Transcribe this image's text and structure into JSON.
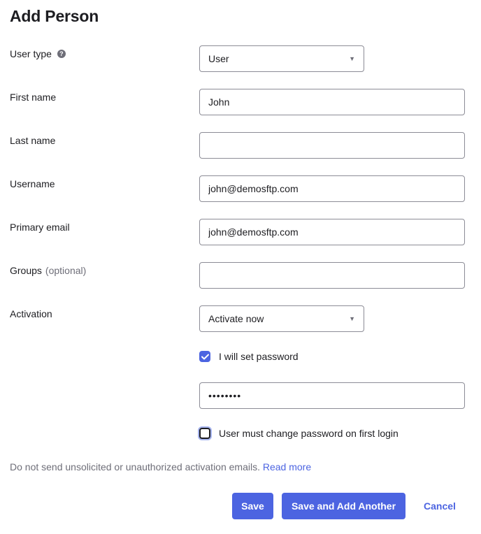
{
  "page": {
    "title": "Add Person"
  },
  "form": {
    "user_type": {
      "label": "User type",
      "help_icon": "question-circle-icon",
      "help_glyph": "?",
      "value": "User"
    },
    "first_name": {
      "label": "First name",
      "value": "John"
    },
    "last_name": {
      "label": "Last name",
      "value": ""
    },
    "username": {
      "label": "Username",
      "value": "john@demosftp.com"
    },
    "primary_email": {
      "label": "Primary email",
      "value": "john@demosftp.com"
    },
    "groups": {
      "label": "Groups",
      "optional": "(optional)",
      "value": ""
    },
    "activation": {
      "label": "Activation",
      "value": "Activate now"
    },
    "set_password": {
      "label": "I will set password",
      "checked": true
    },
    "password": {
      "value": "••••••••"
    },
    "must_change": {
      "label": "User must change password on first login",
      "checked": false
    }
  },
  "notice": {
    "text": "Do not send unsolicited or unauthorized activation emails.",
    "link": "Read more"
  },
  "actions": {
    "save": "Save",
    "save_add_another": "Save and Add Another",
    "cancel": "Cancel"
  },
  "colors": {
    "accent": "#4c64e1",
    "text": "#1d1d21",
    "muted": "#6e6e78",
    "border": "#8c8c96"
  },
  "icons": {
    "dropdown": "caret-down-icon",
    "check": "checkmark-icon"
  }
}
